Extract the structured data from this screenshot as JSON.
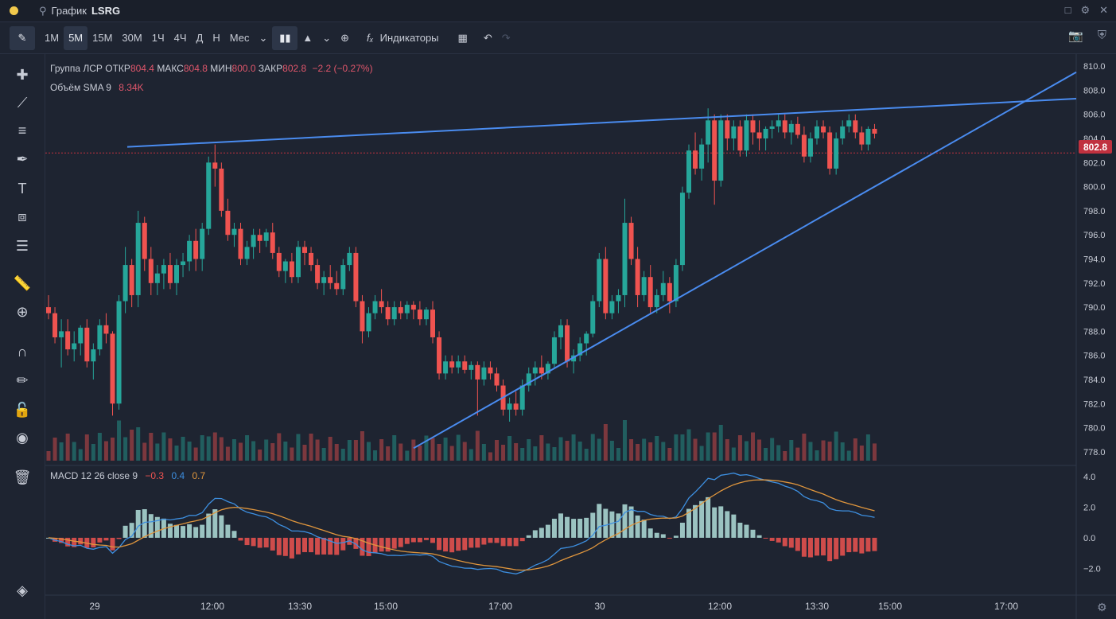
{
  "titlebar": {
    "search_icon": "search-icon",
    "title": "График",
    "symbol": "LSRG"
  },
  "toolbar": {
    "timeframes": [
      "1М",
      "5М",
      "15М",
      "30М",
      "1Ч",
      "4Ч",
      "Д",
      "Н",
      "Мес"
    ],
    "active_timeframe": "5М",
    "indicators_label": "Индикаторы"
  },
  "legend": {
    "name": "Группа ЛСР",
    "open_label": "ОТКР",
    "open": "804.4",
    "high_label": "МАКС",
    "high": "804.8",
    "low_label": "МИН",
    "low": "800.0",
    "close_label": "ЗАКР",
    "close": "802.8",
    "change": "−2.2 (−0.27%)",
    "volume_label": "Объём SMA 9",
    "volume_value": "8.34K",
    "macd_label": "MACD 12 26 close 9",
    "macd_hist": "−0.3",
    "macd_line": "0.4",
    "macd_signal": "0.7"
  },
  "price_axis": [
    "810.0",
    "808.0",
    "806.0",
    "804.0",
    "802.0",
    "800.0",
    "798.0",
    "796.0",
    "794.0",
    "792.0",
    "790.0",
    "788.0",
    "786.0",
    "784.0",
    "782.0",
    "780.0",
    "778.0"
  ],
  "current_price": "802.8",
  "macd_axis": [
    "4.0",
    "2.0",
    "0.0",
    "−2.0"
  ],
  "time_axis": [
    "29",
    "12:00",
    "13:30",
    "15:00",
    "17:00",
    "30",
    "12:00",
    "13:30",
    "15:00",
    "17:00"
  ],
  "colors": {
    "up": "#26a69a",
    "down": "#ef5350",
    "trend": "#4a8cf0",
    "macd": "#3d8fe0",
    "signal": "#e0963d"
  },
  "chart_data": {
    "type": "candlestick",
    "symbol": "LSRG",
    "ylim": [
      777,
      811
    ],
    "candles": [
      [
        790,
        791,
        789,
        789.5
      ],
      [
        789.5,
        790,
        787,
        787.5
      ],
      [
        787.5,
        789,
        785,
        788
      ],
      [
        788,
        789,
        786,
        786.5
      ],
      [
        786.5,
        788,
        785.5,
        787
      ],
      [
        787,
        788.5,
        786,
        788.3
      ],
      [
        788.3,
        789,
        785,
        785.5
      ],
      [
        785.5,
        787,
        784,
        786.5
      ],
      [
        786.5,
        789,
        786,
        788.5
      ],
      [
        788.5,
        789.5,
        787,
        787.8
      ],
      [
        787.8,
        788,
        781,
        782
      ],
      [
        782,
        791,
        781.5,
        790.5
      ],
      [
        790.5,
        795,
        789.5,
        793.5
      ],
      [
        793.5,
        794,
        790,
        791
      ],
      [
        791,
        798,
        790,
        797
      ],
      [
        797,
        797.5,
        793,
        794
      ],
      [
        794,
        795,
        791,
        792
      ],
      [
        792,
        793.5,
        791,
        792.8
      ],
      [
        792.8,
        794,
        791.5,
        793.5
      ],
      [
        793.5,
        794.5,
        791.5,
        792
      ],
      [
        792,
        794,
        791,
        793.5
      ],
      [
        793.5,
        794.5,
        792.5,
        793.8
      ],
      [
        793.8,
        796,
        793,
        795.5
      ],
      [
        795.5,
        796.5,
        793,
        794
      ],
      [
        794,
        797,
        793,
        796.5
      ],
      [
        796.5,
        802.5,
        796,
        802
      ],
      [
        802,
        803.5,
        800,
        801.5
      ],
      [
        801.5,
        802,
        797.5,
        798
      ],
      [
        798,
        799,
        795.5,
        796
      ],
      [
        796,
        797,
        795,
        796.5
      ],
      [
        796.5,
        797,
        793.5,
        794
      ],
      [
        794,
        795.5,
        793.5,
        795
      ],
      [
        795,
        796.5,
        794,
        796
      ],
      [
        796,
        796.5,
        794.5,
        795.5
      ],
      [
        795.5,
        796.5,
        795,
        796.2
      ],
      [
        796.2,
        797,
        794,
        794.5
      ],
      [
        794.5,
        795,
        792.5,
        793
      ],
      [
        793,
        794,
        792,
        793.8
      ],
      [
        793.8,
        794.5,
        792,
        792.5
      ],
      [
        792.5,
        795.5,
        792,
        795
      ],
      [
        795,
        795.5,
        793.5,
        794.5
      ],
      [
        794.5,
        795,
        793,
        793.5
      ],
      [
        793.5,
        794,
        791.5,
        792
      ],
      [
        792,
        793,
        791,
        792.5
      ],
      [
        792.5,
        793.5,
        791.5,
        792
      ],
      [
        792,
        793,
        791,
        791.5
      ],
      [
        791.5,
        794,
        791,
        793.5
      ],
      [
        793.5,
        795,
        793,
        794.5
      ],
      [
        794.5,
        795,
        790,
        790.5
      ],
      [
        790.5,
        791,
        787,
        788
      ],
      [
        788,
        790,
        787.5,
        789.5
      ],
      [
        789.5,
        791,
        789,
        790.5
      ],
      [
        790.5,
        791.5,
        789.5,
        790
      ],
      [
        790,
        790.5,
        788.5,
        789
      ],
      [
        789,
        790.5,
        788.5,
        790
      ],
      [
        790,
        790.5,
        789,
        789.5
      ],
      [
        789.5,
        790.5,
        789,
        790.2
      ],
      [
        790.2,
        790.5,
        789,
        789.8
      ],
      [
        789.8,
        790.5,
        788.5,
        789
      ],
      [
        789,
        790,
        788.5,
        789.8
      ],
      [
        789.8,
        790.5,
        787,
        787.5
      ],
      [
        787.5,
        788,
        784,
        784.5
      ],
      [
        784.5,
        786,
        784,
        785.5
      ],
      [
        785.5,
        786,
        784.5,
        785
      ],
      [
        785,
        786,
        784.5,
        785.5
      ],
      [
        785.5,
        786,
        784.5,
        784.8
      ],
      [
        784.8,
        785.5,
        784,
        785.2
      ],
      [
        785.2,
        785.5,
        781,
        784
      ],
      [
        784,
        785.5,
        783.5,
        785
      ],
      [
        785,
        785.5,
        784,
        784.5
      ],
      [
        784.5,
        785,
        783,
        783.5
      ],
      [
        783.5,
        784,
        781,
        781.5
      ],
      [
        781.5,
        782.5,
        780.5,
        782
      ],
      [
        782,
        783,
        781,
        781.5
      ],
      [
        781.5,
        784,
        781,
        783.5
      ],
      [
        783.5,
        785,
        783,
        784.5
      ],
      [
        784.5,
        785.5,
        783.5,
        785
      ],
      [
        785,
        786,
        784,
        784.5
      ],
      [
        784.5,
        785.5,
        784,
        785.3
      ],
      [
        785.3,
        788,
        785,
        787.5
      ],
      [
        787.5,
        789,
        786.5,
        788.5
      ],
      [
        788.5,
        789,
        785,
        785.5
      ],
      [
        785.5,
        786.5,
        784.5,
        786
      ],
      [
        786,
        787.5,
        785.5,
        787
      ],
      [
        787,
        788,
        786,
        787.8
      ],
      [
        787.8,
        791,
        787.5,
        790.5
      ],
      [
        790.5,
        794.5,
        790,
        794
      ],
      [
        794,
        795,
        789,
        789.5
      ],
      [
        789.5,
        791,
        789,
        790.5
      ],
      [
        790.5,
        791.5,
        789.5,
        791
      ],
      [
        791,
        799,
        790,
        797
      ],
      [
        797,
        797.5,
        793.5,
        794
      ],
      [
        794,
        795,
        790,
        791
      ],
      [
        791,
        793,
        790.5,
        792.5
      ],
      [
        792.5,
        793.5,
        789.5,
        790
      ],
      [
        790,
        791.5,
        789.5,
        791
      ],
      [
        791,
        793,
        790.5,
        792
      ],
      [
        792,
        792.5,
        789.5,
        790.5
      ],
      [
        790.5,
        794,
        790,
        793.5
      ],
      [
        793.5,
        800,
        793,
        799.5
      ],
      [
        799.5,
        803.5,
        799,
        803
      ],
      [
        803,
        804.5,
        801,
        801.5
      ],
      [
        801.5,
        804,
        800.5,
        803.5
      ],
      [
        803.5,
        806.5,
        802,
        805.5
      ],
      [
        805.5,
        806,
        798.5,
        800.5
      ],
      [
        800.5,
        806,
        800,
        805.5
      ],
      [
        805.5,
        806,
        803,
        804
      ],
      [
        804,
        805.5,
        803,
        805
      ],
      [
        805,
        805.5,
        802.5,
        803
      ],
      [
        803,
        806,
        802.5,
        805.5
      ],
      [
        805.5,
        806,
        803.5,
        804.5
      ],
      [
        804.5,
        805.5,
        803,
        804
      ],
      [
        804,
        805,
        803,
        804.8
      ],
      [
        804.8,
        805.5,
        804,
        805
      ],
      [
        805,
        806,
        804.5,
        805.5
      ],
      [
        805.5,
        806,
        804,
        804.5
      ],
      [
        804.5,
        805.5,
        803.5,
        805.2
      ],
      [
        805.2,
        805.8,
        804,
        804.3
      ],
      [
        804.3,
        805,
        802,
        802.5
      ],
      [
        802.5,
        804.5,
        802,
        804
      ],
      [
        804,
        805.5,
        803.5,
        805
      ],
      [
        805,
        805.5,
        804,
        804.5
      ],
      [
        804.5,
        805,
        801,
        801.5
      ],
      [
        801.5,
        804.5,
        801,
        804
      ],
      [
        804,
        805.5,
        803.5,
        805
      ],
      [
        805,
        806,
        804.5,
        805.5
      ],
      [
        805.5,
        806,
        804,
        804.5
      ],
      [
        804.5,
        805,
        803,
        803.5
      ],
      [
        803.5,
        805,
        803,
        804.8
      ],
      [
        804.8,
        805.2,
        804,
        804.4
      ]
    ],
    "macd": {
      "line": 0.4,
      "signal": 0.7,
      "histogram": -0.3
    }
  }
}
